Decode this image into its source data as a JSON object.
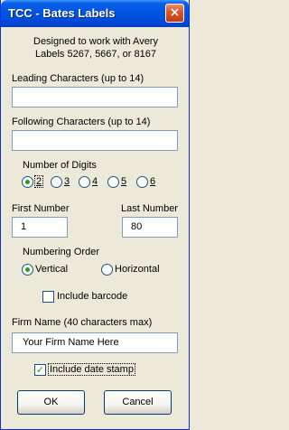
{
  "window": {
    "title": "TCC - Bates Labels",
    "close_label": "×"
  },
  "intro": {
    "line1": "Designed to work with Avery",
    "line2": "Labels 5267, 5667, or 8167"
  },
  "leading": {
    "label": "Leading Characters (up to 14)",
    "value": ""
  },
  "following": {
    "label": "Following Characters (up to 14)",
    "value": ""
  },
  "digits": {
    "label": "Number of Digits",
    "options": [
      "2",
      "3",
      "4",
      "5",
      "6"
    ],
    "selected": "2"
  },
  "first_number": {
    "label": "First Number",
    "value": "1"
  },
  "last_number": {
    "label": "Last Number",
    "value": "80"
  },
  "order": {
    "label": "Numbering Order",
    "vertical": "Vertical",
    "horizontal": "Horizontal",
    "selected": "Vertical"
  },
  "barcode": {
    "label": "Include barcode",
    "checked": false
  },
  "firm": {
    "label": "Firm Name (40 characters max)",
    "value": "Your Firm Name Here"
  },
  "date_stamp": {
    "label": "Include date stamp",
    "checked": true
  },
  "buttons": {
    "ok": "OK",
    "cancel": "Cancel"
  }
}
